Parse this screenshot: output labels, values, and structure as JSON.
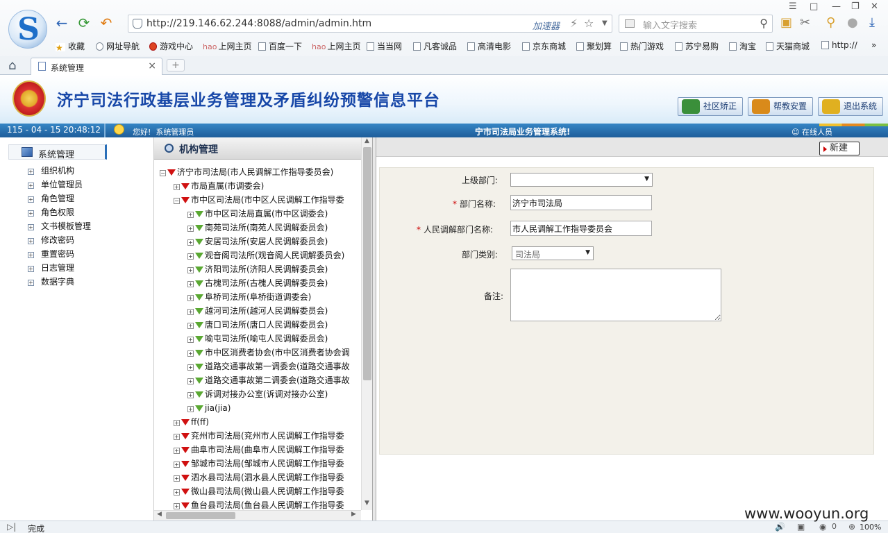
{
  "browser": {
    "address_url": "http://219.146.62.244:8088/admin/admin.htm",
    "accelerator_label": "加速器",
    "search_placeholder": "输入文字搜索",
    "favorites": [
      {
        "label": "收藏",
        "icon": "star-icon"
      },
      {
        "label": "网址导航",
        "icon": "globe-icon"
      },
      {
        "label": "游戏中心",
        "icon": "game-icon"
      },
      {
        "label": "上网主页",
        "icon": "hao-icon"
      },
      {
        "label": "百度一下",
        "icon": "page-icon"
      },
      {
        "label": "上网主页",
        "icon": "hao-icon"
      },
      {
        "label": "当当网",
        "icon": "page-icon"
      },
      {
        "label": "凡客诚品",
        "icon": "page-icon"
      },
      {
        "label": "高清电影",
        "icon": "page-icon"
      },
      {
        "label": "京东商城",
        "icon": "page-icon"
      },
      {
        "label": "聚划算",
        "icon": "page-icon"
      },
      {
        "label": "热门游戏",
        "icon": "page-icon"
      },
      {
        "label": "苏宁易购",
        "icon": "page-icon"
      },
      {
        "label": "淘宝",
        "icon": "page-icon"
      },
      {
        "label": "天猫商城",
        "icon": "page-icon"
      },
      {
        "label": "http://",
        "icon": "page-icon"
      }
    ],
    "hao_prefix": "hao",
    "tab_title": "系统管理",
    "status_text": "完成",
    "zoom": "100%",
    "status_count": "0"
  },
  "app": {
    "title": "济宁司法行政基层业务管理及矛盾纠纷预警信息平台",
    "top_buttons": [
      {
        "label": "社区矫正",
        "color": "#3a8f3a"
      },
      {
        "label": "帮教安置",
        "color": "#d98a1a"
      },
      {
        "label": "退出系统",
        "color": "#e0b020"
      }
    ],
    "datetime": "115 - 04 - 15  20:48:12",
    "greeting": "您好!",
    "user": "系统管理员",
    "system_name": "宁市司法局业务管理系统!",
    "online_label": "在线人员"
  },
  "sidebar": {
    "header": "系统管理",
    "items": [
      "组织机构",
      "单位管理员",
      "角色管理",
      "角色权限",
      "文书模板管理",
      "修改密码",
      "重置密码",
      "日志管理",
      "数据字典"
    ]
  },
  "tree": {
    "title": "机构管理",
    "rows": [
      {
        "text": "济宁市司法局(市人民调解工作指导委员会)",
        "level": 0,
        "flag": "red",
        "sign": "-"
      },
      {
        "text": "市局直属(市调委会)",
        "level": 1,
        "flag": "red",
        "sign": "+"
      },
      {
        "text": "市中区司法局(市中区人民调解工作指导委",
        "level": 1,
        "flag": "red",
        "sign": "-"
      },
      {
        "text": "市中区司法局直属(市中区调委会)",
        "level": 2,
        "flag": "green",
        "sign": "+"
      },
      {
        "text": "南苑司法所(南苑人民调解委员会)",
        "level": 2,
        "flag": "green",
        "sign": "+"
      },
      {
        "text": "安居司法所(安居人民调解委员会)",
        "level": 2,
        "flag": "green",
        "sign": "+"
      },
      {
        "text": "观音阁司法所(观音阁人民调解委员会)",
        "level": 2,
        "flag": "green",
        "sign": "+"
      },
      {
        "text": "济阳司法所(济阳人民调解委员会)",
        "level": 2,
        "flag": "green",
        "sign": "+"
      },
      {
        "text": "古槐司法所(古槐人民调解委员会)",
        "level": 2,
        "flag": "green",
        "sign": "+"
      },
      {
        "text": "阜桥司法所(阜桥街道调委会)",
        "level": 2,
        "flag": "green",
        "sign": "+"
      },
      {
        "text": "越河司法所(越河人民调解委员会)",
        "level": 2,
        "flag": "green",
        "sign": "+"
      },
      {
        "text": "唐口司法所(唐口人民调解委员会)",
        "level": 2,
        "flag": "green",
        "sign": "+"
      },
      {
        "text": "喻屯司法所(喻屯人民调解委员会)",
        "level": 2,
        "flag": "green",
        "sign": "+"
      },
      {
        "text": "市中区消费者协会(市中区消费者协会调",
        "level": 2,
        "flag": "green",
        "sign": "+"
      },
      {
        "text": "道路交通事故第一调委会(道路交通事故",
        "level": 2,
        "flag": "green",
        "sign": "+"
      },
      {
        "text": "道路交通事故第二调委会(道路交通事故",
        "level": 2,
        "flag": "green",
        "sign": "+"
      },
      {
        "text": "诉调对接办公室(诉调对接办公室)",
        "level": 2,
        "flag": "green",
        "sign": "+"
      },
      {
        "text": "jia(jia)",
        "level": 2,
        "flag": "green",
        "sign": "+"
      },
      {
        "text": "ff(ff)",
        "level": 1,
        "flag": "red",
        "sign": "+"
      },
      {
        "text": "兖州市司法局(兖州市人民调解工作指导委",
        "level": 1,
        "flag": "red",
        "sign": "+"
      },
      {
        "text": "曲阜市司法局(曲阜市人民调解工作指导委",
        "level": 1,
        "flag": "red",
        "sign": "+"
      },
      {
        "text": "邹城市司法局(邹城市人民调解工作指导委",
        "level": 1,
        "flag": "red",
        "sign": "+"
      },
      {
        "text": "泗水县司法局(泗水县人民调解工作指导委",
        "level": 1,
        "flag": "red",
        "sign": "+"
      },
      {
        "text": "微山县司法局(微山县人民调解工作指导委",
        "level": 1,
        "flag": "red",
        "sign": "+"
      },
      {
        "text": "鱼台县司法局(鱼台县人民调解工作指导委",
        "level": 1,
        "flag": "red",
        "sign": "+"
      }
    ]
  },
  "form": {
    "new_label": "新建",
    "parent_label": "上级部门:",
    "parent_value": "",
    "dept_name_label": "部门名称:",
    "dept_name_value": "济宁市司法局",
    "mediation_label": "人民调解部门名称:",
    "mediation_value": "市人民调解工作指导委员会",
    "dept_type_label": "部门类别:",
    "dept_type_value": "司法局",
    "remark_label": "备注:",
    "remark_value": "",
    "required_mark": "*"
  },
  "watermark": "www.wooyun.org"
}
